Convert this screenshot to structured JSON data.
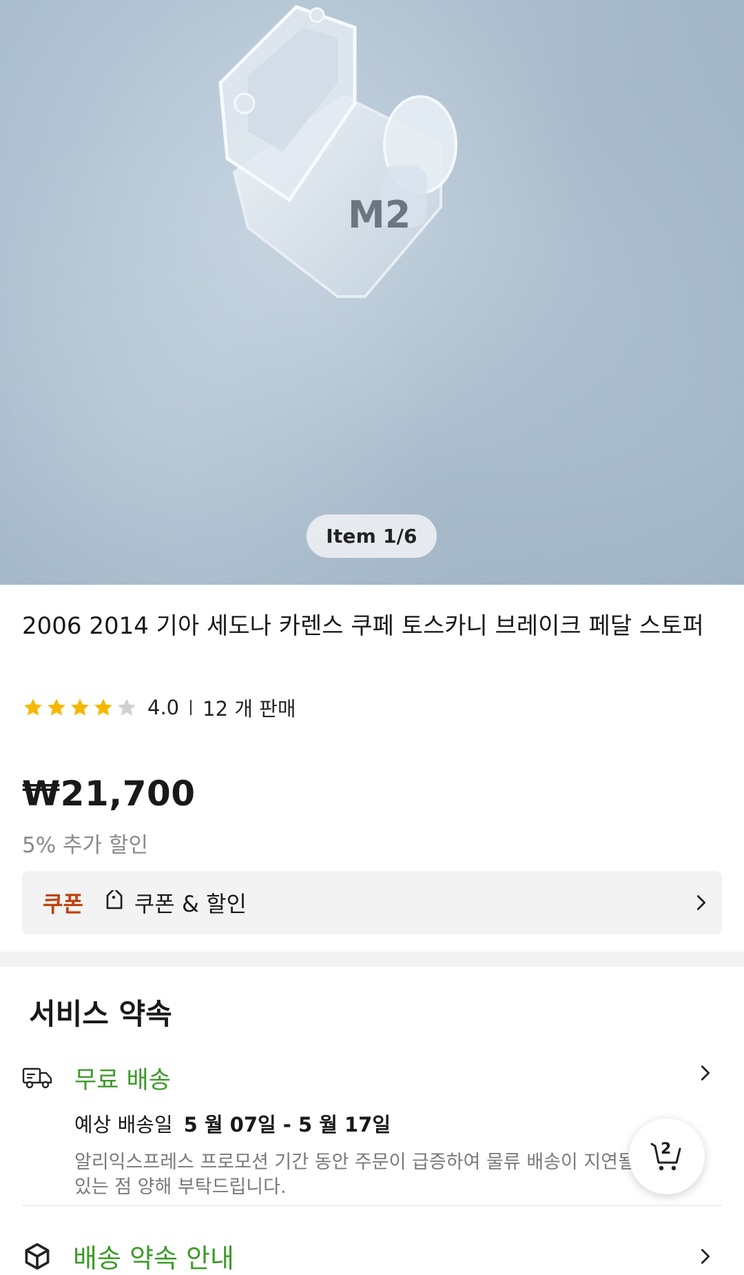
{
  "gallery": {
    "counter": "Item 1/6",
    "product_marking": "M2"
  },
  "product": {
    "title": "2006 2014 기아 세도나 카렌스 쿠페 토스카니 브레이크 페달 스토퍼",
    "rating": "4.0",
    "rating_stars_filled": 4,
    "rating_stars_total": 5,
    "sold": "12 개 판매",
    "price": "₩21,700",
    "extra_discount": "5% 추가 할인"
  },
  "coupon": {
    "tag": "쿠폰",
    "label": "쿠폰 & 할인"
  },
  "service": {
    "title": "서비스 약속",
    "free_shipping": "무료 배송",
    "eta_label": "예상 배송일",
    "eta_value": "5 월 07일 - 5 월 17일",
    "notice": "알리익스프레스 프로모션 기간 동안 주문이 급증하여 물류 배송이 지연될 수 있는 점 양해 부탁드립니다.",
    "delivery_promise": "배송 약속 안내"
  },
  "cart": {
    "count": "2"
  },
  "colors": {
    "accent_green": "#3d9a28",
    "coupon_orange": "#c2410c",
    "star_yellow": "#f5b800",
    "star_gray": "#d0d0d0"
  },
  "icons": [
    "star-icon",
    "tag-icon",
    "chevron-right-icon",
    "truck-icon",
    "box-icon",
    "cart-icon"
  ]
}
